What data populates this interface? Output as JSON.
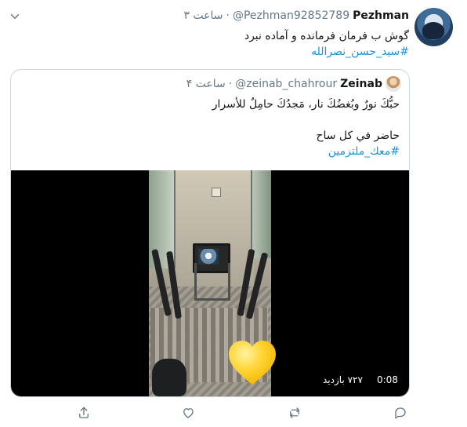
{
  "tweet": {
    "author_name": "Pezhman",
    "author_handle": "@Pezhman92852789",
    "separator": "·",
    "time": "۳ ساعت",
    "text_line1": "گوش ب فرمان فرمانده و آماده نبرد",
    "hashtag": "#سید_حسن_نصرالله"
  },
  "quoted": {
    "author_name": "Zeinab",
    "author_handle": "@zeinab_chahrour",
    "separator": "·",
    "time": "۴ ساعت",
    "line1": "حبُّكَ نورٌ وبُغضُكَ نار، مَجدُكَ حامِلٌ للأسرار",
    "line2": "حاضر في كل ساح",
    "hashtag": "#معك_ملتزمين"
  },
  "video": {
    "duration": "0:08",
    "views": "۷۲۷ بازدید"
  },
  "icons": {
    "menu": "chevron-down-icon",
    "share": "share-icon",
    "like": "heart-icon",
    "retweet": "retweet-icon",
    "reply": "reply-icon"
  },
  "colors": {
    "hashtag": "#1b95e0",
    "muted": "#657786",
    "border": "#ccd6dd"
  }
}
